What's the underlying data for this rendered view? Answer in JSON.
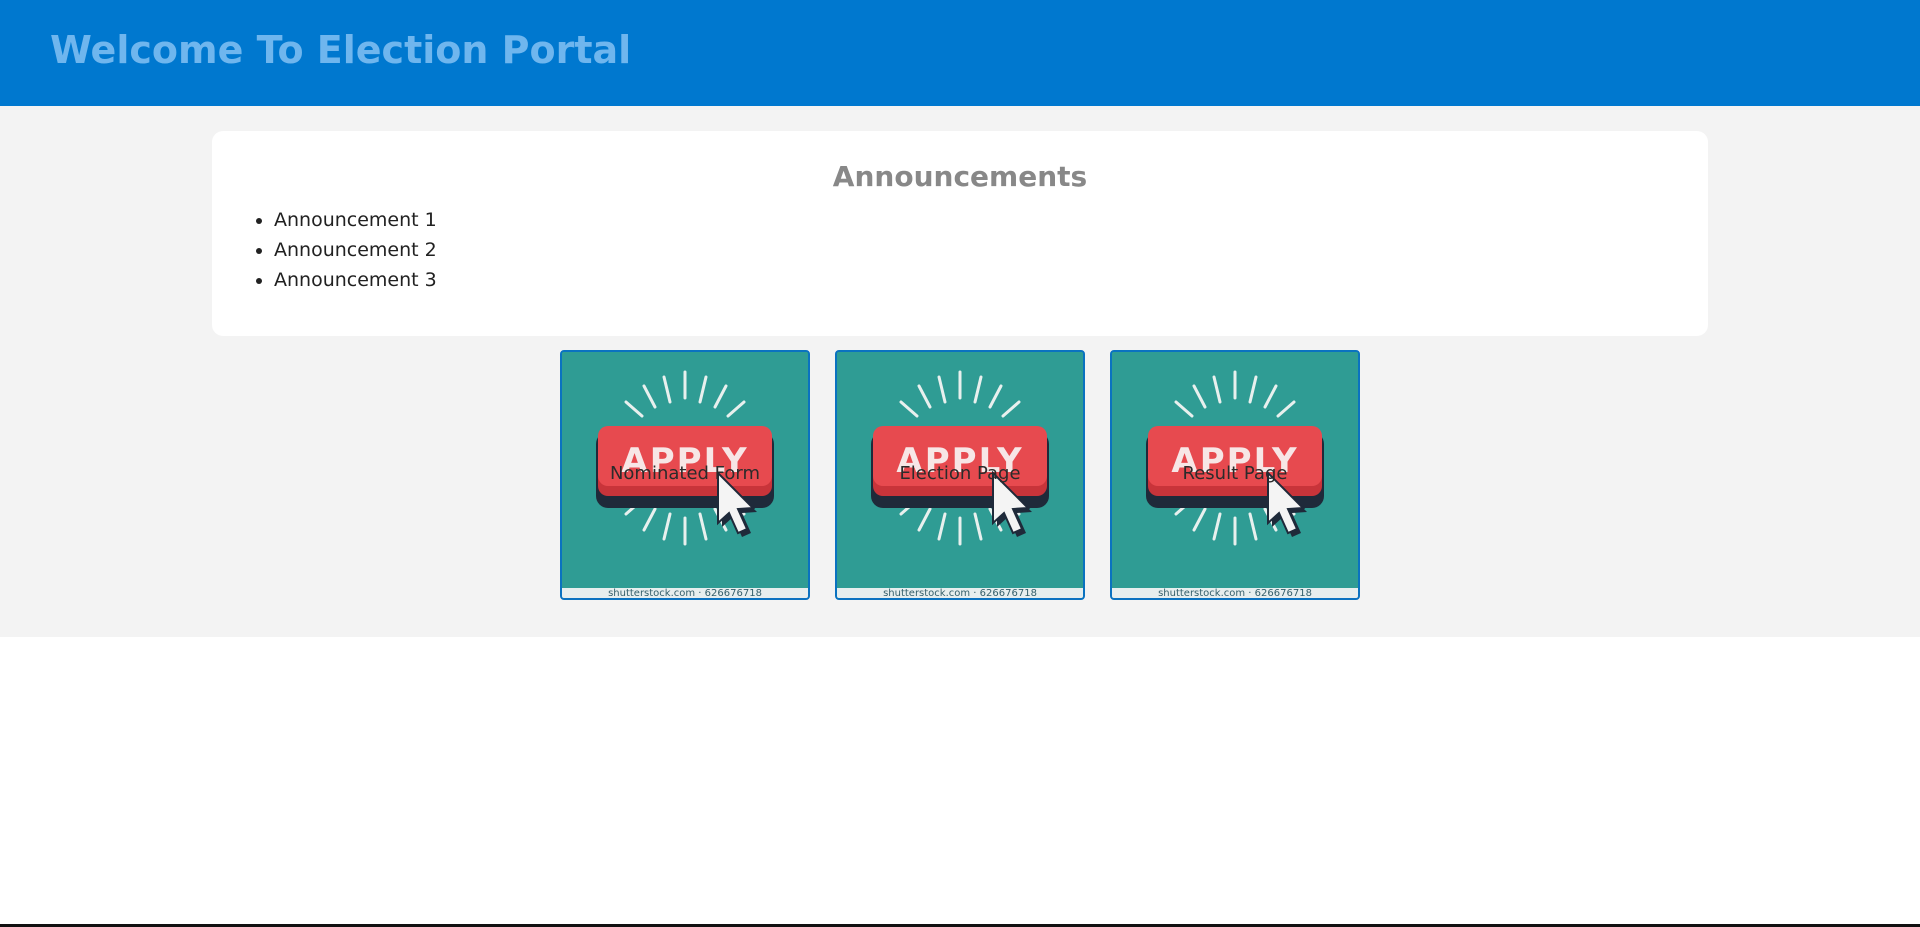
{
  "header": {
    "title": "Welcome To Election Portal"
  },
  "announcements": {
    "heading": "Announcements",
    "items": [
      {
        "label": "Announcement 1"
      },
      {
        "label": "Announcement 2"
      },
      {
        "label": "Announcement 3"
      }
    ]
  },
  "tiles": [
    {
      "label": "Nominated Form",
      "image_text": "APPLY",
      "credit": "shutterstock.com · 626676718"
    },
    {
      "label": "Election Page",
      "image_text": "APPLY",
      "credit": "shutterstock.com · 626676718"
    },
    {
      "label": "Result Page",
      "image_text": "APPLY",
      "credit": "shutterstock.com · 626676718"
    }
  ],
  "colors": {
    "header_bg": "#0078cf",
    "header_text": "#6fb6ee",
    "page_bg": "#f3f3f3",
    "tile_bg": "#2f9c94",
    "tile_border": "#0a72c0",
    "apply_button": "#e74a4f"
  },
  "icons": {
    "tile_image": "apply-button-cursor-icon"
  }
}
